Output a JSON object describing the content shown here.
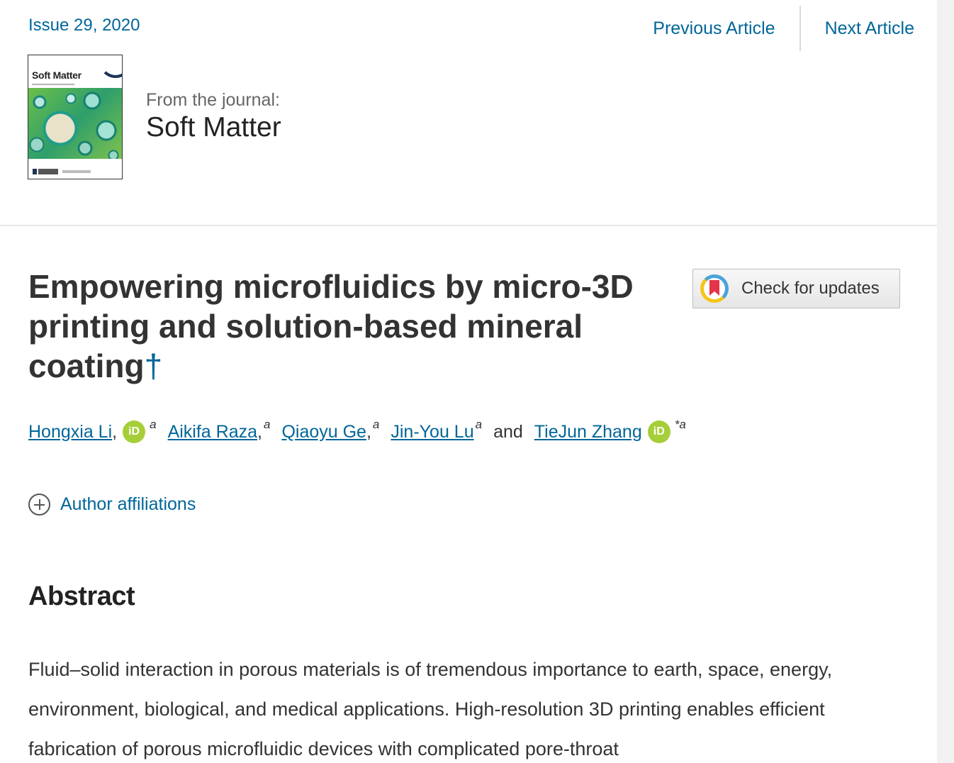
{
  "nav": {
    "issue": "Issue 29, 2020",
    "previous": "Previous Article",
    "next": "Next Article"
  },
  "journal": {
    "cover_title": "Soft Matter",
    "from_label": "From the journal:",
    "name": "Soft Matter"
  },
  "article": {
    "title": "Empowering microfluidics by micro-3D printing and solution-based mineral coating",
    "dagger": "†",
    "check_updates": "Check for updates"
  },
  "authors": [
    {
      "name": "Hongxia Li",
      "sep": ",",
      "orcid": "iD",
      "sup": "a"
    },
    {
      "name": "Aikifa Raza",
      "sep": ",",
      "sup": "a"
    },
    {
      "name": "Qiaoyu Ge",
      "sep": ",",
      "sup": "a"
    },
    {
      "name": "Jin-You Lu",
      "sep": "",
      "sup": "a"
    },
    {
      "name": "TieJun Zhang",
      "sep": "",
      "orcid": "iD",
      "sup": "*a"
    }
  ],
  "authors_and": "and",
  "affiliations": {
    "label": "Author affiliations",
    "icon": "plus-circle-icon"
  },
  "abstract": {
    "heading": "Abstract",
    "text": "Fluid–solid interaction in porous materials is of tremendous importance to earth, space, energy, environment, biological, and medical applications. High-resolution 3D printing enables efficient fabrication of porous microfluidic devices with complicated pore-throat"
  },
  "colors": {
    "link": "#006699",
    "orcid": "#a6ce39",
    "text": "#333333"
  }
}
